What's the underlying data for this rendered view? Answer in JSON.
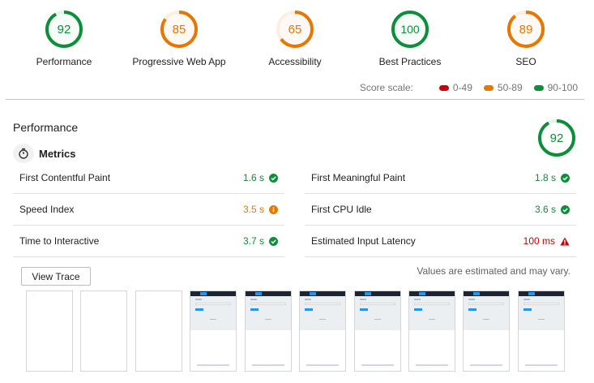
{
  "categories": [
    {
      "score": "92",
      "label": "Performance",
      "fraction": 0.92,
      "color": "#0c8e3a",
      "ring": "#e4f5ea"
    },
    {
      "score": "85",
      "label": "Progressive Web App",
      "fraction": 0.85,
      "color": "#e67700",
      "ring": "#fdefe0"
    },
    {
      "score": "65",
      "label": "Accessibility",
      "fraction": 0.65,
      "color": "#e67700",
      "ring": "#fdefe0"
    },
    {
      "score": "100",
      "label": "Best Practices",
      "fraction": 1.0,
      "color": "#0c8e3a",
      "ring": "#e4f5ea"
    },
    {
      "score": "89",
      "label": "SEO",
      "fraction": 0.89,
      "color": "#e67700",
      "ring": "#fdefe0"
    }
  ],
  "score_scale": {
    "label": "Score scale:",
    "items": [
      {
        "range": "0-49",
        "color": "#cc0000"
      },
      {
        "range": "50-89",
        "color": "#e67700"
      },
      {
        "range": "90-100",
        "color": "#0c8e3a"
      }
    ]
  },
  "performance": {
    "title": "Performance",
    "score": "92",
    "fraction": 0.92,
    "metrics_title": "Metrics",
    "metrics_left": [
      {
        "name": "First Contentful Paint",
        "value": "1.6 s",
        "status": "pass",
        "icon": "check-circle-icon"
      },
      {
        "name": "Speed Index",
        "value": "3.5 s",
        "status": "average",
        "icon": "info-circle-icon"
      },
      {
        "name": "Time to Interactive",
        "value": "3.7 s",
        "status": "pass",
        "icon": "check-circle-icon"
      }
    ],
    "metrics_right": [
      {
        "name": "First Meaningful Paint",
        "value": "1.8 s",
        "status": "pass",
        "icon": "check-circle-icon"
      },
      {
        "name": "First CPU Idle",
        "value": "3.6 s",
        "status": "pass",
        "icon": "check-circle-icon"
      },
      {
        "name": "Estimated Input Latency",
        "value": "100 ms",
        "status": "fail",
        "icon": "warning-triangle-icon"
      }
    ],
    "view_trace_label": "View Trace",
    "estimate_note": "Values are estimated and may vary."
  }
}
